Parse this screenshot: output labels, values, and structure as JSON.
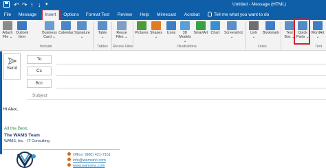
{
  "window": {
    "title": "Untitled  -  Message (HTML)",
    "quick_access": [
      "save-icon",
      "undo-icon",
      "redo-icon",
      "up-icon",
      "down-icon"
    ]
  },
  "tabs": [
    {
      "label": "File"
    },
    {
      "label": "Message"
    },
    {
      "label": "Insert",
      "active": true
    },
    {
      "label": "Options"
    },
    {
      "label": "Format Text"
    },
    {
      "label": "Review"
    },
    {
      "label": "Help"
    },
    {
      "label": "Mimecast"
    },
    {
      "label": "Acrobat"
    }
  ],
  "tell_me": "Tell me what you want to do",
  "ribbon": {
    "buttons": [
      {
        "label": "Attach\nFile ⌄",
        "icon": "paperclip-icon",
        "color": "#8a8a8a"
      },
      {
        "label": "Outlook\nItem",
        "icon": "outlook-item-icon",
        "color": "#3b79c3"
      },
      {
        "label": "Business\nCard ⌄",
        "icon": "business-card-icon",
        "color": "#6a9bd1"
      },
      {
        "label": "Calendar",
        "icon": "calendar-icon",
        "color": "#4a86c8"
      },
      {
        "label": "Signature\n⌄",
        "icon": "signature-icon",
        "color": "#5b8fc9"
      },
      {
        "label": "Table\n⌄",
        "icon": "table-icon",
        "color": "#5b8fc9"
      },
      {
        "label": "Reuse\nFiles ⌄",
        "icon": "reuse-files-icon",
        "color": "#7e9fc4"
      },
      {
        "label": "Pictures",
        "icon": "pictures-icon",
        "color": "#4e9a3a"
      },
      {
        "label": "Shapes\n⌄",
        "icon": "shapes-icon",
        "color": "#e07b24"
      },
      {
        "label": "Icons",
        "icon": "icons-icon",
        "color": "#3f7dc4"
      },
      {
        "label": "3D\nModels ⌄",
        "icon": "3d-models-icon",
        "color": "#5aa0d8"
      },
      {
        "label": "SmartArt",
        "icon": "smartart-icon",
        "color": "#3aa046"
      },
      {
        "label": "Chart",
        "icon": "chart-icon",
        "color": "#3a8fd0"
      },
      {
        "label": "Screenshot\n⌄",
        "icon": "screenshot-icon",
        "color": "#5b8fc9"
      },
      {
        "label": "Link\n⌄",
        "icon": "link-icon",
        "color": "#6f6f6f"
      },
      {
        "label": "Bookmark",
        "icon": "bookmark-icon",
        "color": "#3f7dc4"
      },
      {
        "label": "Text\nBox ⌄",
        "icon": "text-box-icon",
        "color": "#5b8fc9"
      },
      {
        "label": "Quick\nParts ⌄",
        "icon": "quick-parts-icon",
        "color": "#4f8bc6"
      },
      {
        "label": "WordArt\n⌄",
        "icon": "wordart-icon",
        "color": "#3f7dc4"
      }
    ],
    "groups": [
      "Include",
      "Tables",
      "Reuse Files",
      "Illustrations",
      "Links",
      "Text"
    ]
  },
  "compose": {
    "send_label": "Send",
    "to_label": "To",
    "cc_label": "Cc",
    "bcc_label": "Bcc",
    "subject_label": "Subject"
  },
  "body": {
    "greeting": "Hi Alex,",
    "closing": "All the Best,",
    "team": "The WAMS Team",
    "company": "WAMS, Inc. - IT Consulting"
  },
  "signature": {
    "office": "Office: (800) 421-7151",
    "email": "info@wamsinc.com",
    "website": "www.wamsinc.com"
  },
  "colors": {
    "brand_blue": "#0f5fa8",
    "highlight_red": "#d21e2b",
    "closing_green": "#2e8b57",
    "team_navy": "#1f3b73"
  }
}
